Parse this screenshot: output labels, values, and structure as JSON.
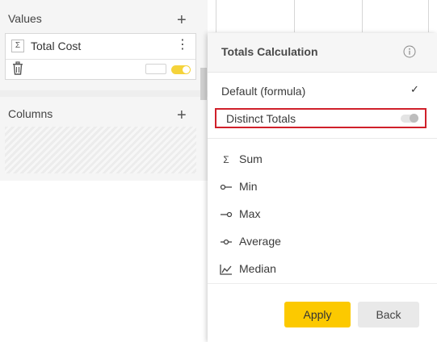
{
  "left_panel": {
    "values_section": {
      "title": "Values",
      "add_label": "+",
      "item": {
        "icon": "sigma-icon",
        "icon_glyph": "Σ",
        "label": "Total Cost",
        "menu_glyph": "⋮"
      }
    },
    "columns_section": {
      "title": "Columns",
      "add_label": "+"
    }
  },
  "popup": {
    "title": "Totals Calculation",
    "default_option": "Default (formula)",
    "default_check": "✓",
    "distinct_totals": {
      "label": "Distinct Totals",
      "enabled": false
    },
    "aggregations": [
      {
        "label": "Sum",
        "icon": "sigma-icon",
        "glyph": "Σ"
      },
      {
        "label": "Min",
        "icon": "min-icon"
      },
      {
        "label": "Max",
        "icon": "max-icon"
      },
      {
        "label": "Average",
        "icon": "average-icon"
      },
      {
        "label": "Median",
        "icon": "median-chart-icon"
      }
    ],
    "apply_label": "Apply",
    "back_label": "Back"
  },
  "colors": {
    "accent": "#fcc900",
    "highlight_border": "#d0202a"
  }
}
